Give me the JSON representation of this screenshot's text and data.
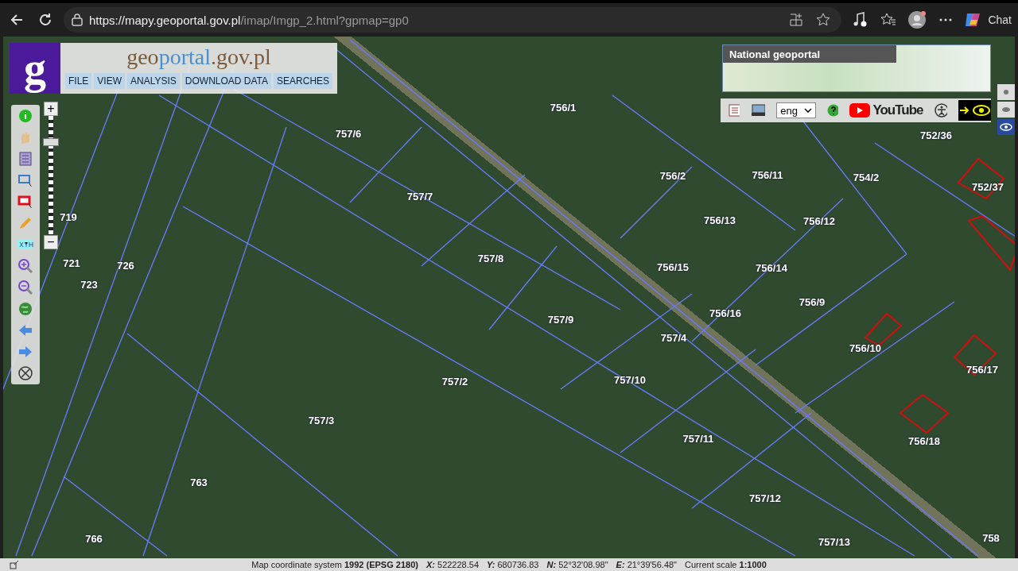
{
  "browser": {
    "url_host": "https://mapy.geoportal.gov.pl",
    "url_path": "/imap/Imgp_2.html?gpmap=gp0",
    "copilot_label": "Chat"
  },
  "header": {
    "logo_letter": "g",
    "title_parts": [
      {
        "text": "geo",
        "kind": "brown"
      },
      {
        "text": "portal",
        "kind": "blue"
      },
      {
        "text": ".gov.pl",
        "kind": "brown"
      }
    ],
    "menu": [
      "FILE",
      "VIEW",
      "ANALYSIS",
      "DOWNLOAD DATA",
      "SEARCHES"
    ]
  },
  "zoom": {
    "plus": "+",
    "minus": "−",
    "level": 0.8
  },
  "overview": {
    "title": "National geoportal"
  },
  "toolbar": {
    "language": "eng",
    "youtube": "YouTube"
  },
  "parcels": [
    "756/1",
    "757/6",
    "757/7",
    "756/2",
    "756/11",
    "754/2",
    "752/36",
    "752/37",
    "756/13",
    "756/12",
    "719",
    "757/8",
    "756/15",
    "756/14",
    "721",
    "726",
    "723",
    "756/9",
    "757/9",
    "756/16",
    "757/4",
    "756/10",
    "756/17",
    "757/2",
    "757/10",
    "757/3",
    "756/18",
    "757/11",
    "763",
    "757/12",
    "766",
    "757/13",
    "758"
  ],
  "status_bar": [
    {
      "kind": "caption",
      "label": "Map coordinate system",
      "value": "1992 (EPSG 2180)"
    },
    {
      "kind": "coord",
      "label": "X:",
      "value": "522228.54"
    },
    {
      "kind": "coord",
      "label": "Y:",
      "value": "680736.83"
    },
    {
      "kind": "coord",
      "label": "N:",
      "value": "52°32'08.98\""
    },
    {
      "kind": "coord",
      "label": "E:",
      "value": "21°39'56.48\""
    },
    {
      "kind": "caption",
      "label": "Current scale",
      "value": "1:1000"
    }
  ]
}
